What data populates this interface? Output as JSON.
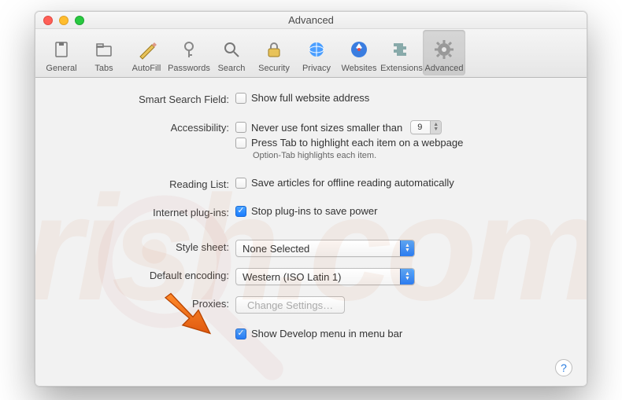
{
  "window_title": "Advanced",
  "toolbar": [
    {
      "label": "General"
    },
    {
      "label": "Tabs"
    },
    {
      "label": "AutoFill"
    },
    {
      "label": "Passwords"
    },
    {
      "label": "Search"
    },
    {
      "label": "Security"
    },
    {
      "label": "Privacy"
    },
    {
      "label": "Websites"
    },
    {
      "label": "Extensions"
    },
    {
      "label": "Advanced",
      "selected": true
    }
  ],
  "sections": {
    "smart_search": {
      "label": "Smart Search Field:",
      "show_full_address": {
        "label": "Show full website address",
        "checked": false
      }
    },
    "accessibility": {
      "label": "Accessibility:",
      "font_size": {
        "label": "Never use font sizes smaller than",
        "value": "9",
        "checked": false
      },
      "press_tab": {
        "label": "Press Tab to highlight each item on a webpage",
        "checked": false
      },
      "option_tab_hint": "Option-Tab highlights each item."
    },
    "reading_list": {
      "label": "Reading List:",
      "save_offline": {
        "label": "Save articles for offline reading automatically",
        "checked": false
      }
    },
    "plugins": {
      "label": "Internet plug-ins:",
      "stop_plugins": {
        "label": "Stop plug-ins to save power",
        "checked": true
      }
    },
    "style_sheet": {
      "label": "Style sheet:",
      "value": "None Selected"
    },
    "default_encoding": {
      "label": "Default encoding:",
      "value": "Western (ISO Latin 1)"
    },
    "proxies": {
      "label": "Proxies:",
      "button": "Change Settings…"
    },
    "develop": {
      "label": "Show Develop menu in menu bar",
      "checked": true
    }
  },
  "help_glyph": "?"
}
